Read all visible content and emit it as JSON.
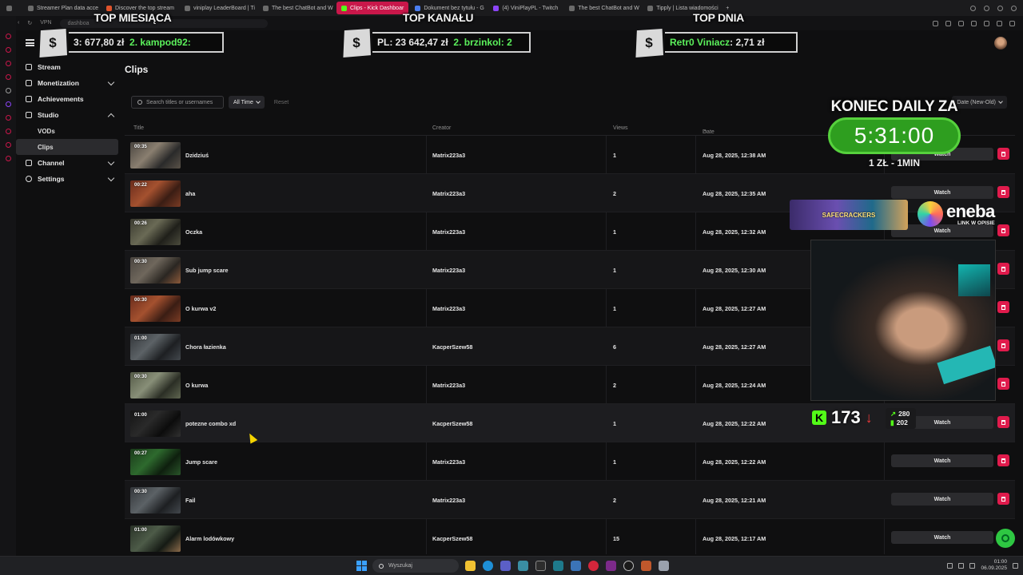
{
  "browser": {
    "tabs": [
      {
        "label": "Streamer Plan data acce",
        "active": false
      },
      {
        "label": "Discover the top stream",
        "active": false
      },
      {
        "label": "viniplay LeaderBoard | Ti",
        "active": false
      },
      {
        "label": "The best ChatBot and W",
        "active": false
      },
      {
        "label": "Clips - Kick Dashboar",
        "active": true
      },
      {
        "label": "Dokument bez tytułu - G",
        "active": false
      },
      {
        "label": "(4) ViniPlayPL - Twitch",
        "active": false
      },
      {
        "label": "The best ChatBot and W",
        "active": false
      },
      {
        "label": "Tipply | Lista wiadomości",
        "active": false
      }
    ],
    "new_tab": "+",
    "address": "dashboa",
    "vpn_badge": "VPN"
  },
  "overlay": {
    "banners": [
      {
        "title": "TOP MIESIĄCA",
        "coin": "$",
        "text_a": "3: 677,80 zł",
        "text_b": "2. kampod92:"
      },
      {
        "title": "TOP KANAŁU",
        "coin": "$",
        "text_a": "PL: 23 642,47 zł",
        "text_b": "2. brzinkol: 2"
      },
      {
        "title": "TOP DNIA",
        "coin": "$",
        "text_a": "Retr0 Viniacz",
        "text_b": ": 2,71 zł"
      }
    ],
    "daily": {
      "title": "KONIEC DAILY ZA",
      "timer": "5:31:00",
      "rate": "1 ZŁ - 1MIN"
    },
    "safecrackers": "SAFECRACKERS",
    "eneba": {
      "name": "eneba",
      "sub": "LINK W OPISIE"
    },
    "kick": {
      "icon": "K",
      "viewers": "173",
      "trend": "↓"
    },
    "stats": {
      "followers": "280",
      "subs": "202"
    }
  },
  "sidebar": {
    "items": [
      {
        "label": "Stream",
        "icon": "stream-icon"
      },
      {
        "label": "Monetization",
        "icon": "dollar-icon",
        "chevron": "down"
      },
      {
        "label": "Achievements",
        "icon": "trophy-icon"
      },
      {
        "label": "Studio",
        "icon": "studio-icon",
        "chevron": "up"
      }
    ],
    "studio_sub": [
      "VODs",
      "Clips"
    ],
    "bottom_items": [
      {
        "label": "Channel",
        "icon": "channel-icon",
        "chevron": "down"
      },
      {
        "label": "Settings",
        "icon": "gear-icon",
        "chevron": "down"
      }
    ]
  },
  "main": {
    "title": "Clips",
    "search_placeholder": "Search titles or usernames",
    "filter": "All Time",
    "reset": "Reset",
    "sort": "Date (New-Old)",
    "columns": {
      "title": "Title",
      "creator": "Creator",
      "views": "Views",
      "date": "Date"
    },
    "watch_label": "Watch",
    "clips": [
      {
        "duration": "00:35",
        "title": "Dzidziuś",
        "creator": "Matrix223a3",
        "views": "1",
        "date": "Aug 28, 2025, 12:38 AM"
      },
      {
        "duration": "00:22",
        "title": "aha",
        "creator": "Matrix223a3",
        "views": "2",
        "date": "Aug 28, 2025, 12:35 AM"
      },
      {
        "duration": "00:26",
        "title": "Oczka",
        "creator": "Matrix223a3",
        "views": "1",
        "date": "Aug 28, 2025, 12:32 AM"
      },
      {
        "duration": "00:30",
        "title": "Sub jump scare",
        "creator": "Matrix223a3",
        "views": "1",
        "date": "Aug 28, 2025, 12:30 AM"
      },
      {
        "duration": "00:30",
        "title": "O kurwa v2",
        "creator": "Matrix223a3",
        "views": "1",
        "date": "Aug 28, 2025, 12:27 AM"
      },
      {
        "duration": "01:00",
        "title": "Chora łazienka",
        "creator": "KacperSzew58",
        "views": "6",
        "date": "Aug 28, 2025, 12:27 AM"
      },
      {
        "duration": "00:30",
        "title": "O kurwa",
        "creator": "Matrix223a3",
        "views": "2",
        "date": "Aug 28, 2025, 12:24 AM"
      },
      {
        "duration": "01:00",
        "title": "potezne combo xd",
        "creator": "KacperSzew58",
        "views": "1",
        "date": "Aug 28, 2025, 12:22 AM"
      },
      {
        "duration": "00:27",
        "title": "Jump scare",
        "creator": "Matrix223a3",
        "views": "1",
        "date": "Aug 28, 2025, 12:22 AM"
      },
      {
        "duration": "00:30",
        "title": "Fail",
        "creator": "Matrix223a3",
        "views": "2",
        "date": "Aug 28, 2025, 12:21 AM"
      },
      {
        "duration": "01:00",
        "title": "Alarm lodówkowy",
        "creator": "KacperSzew58",
        "views": "15",
        "date": "Aug 28, 2025, 12:17 AM"
      }
    ]
  },
  "taskbar": {
    "search_placeholder": "Wyszukaj",
    "time": "01:00",
    "date": "06.09.2025"
  },
  "colors": {
    "accent": "#c9174a",
    "delete": "#e01b4c",
    "kick_green": "#53fc18",
    "timer_green": "#2e9e1f"
  }
}
